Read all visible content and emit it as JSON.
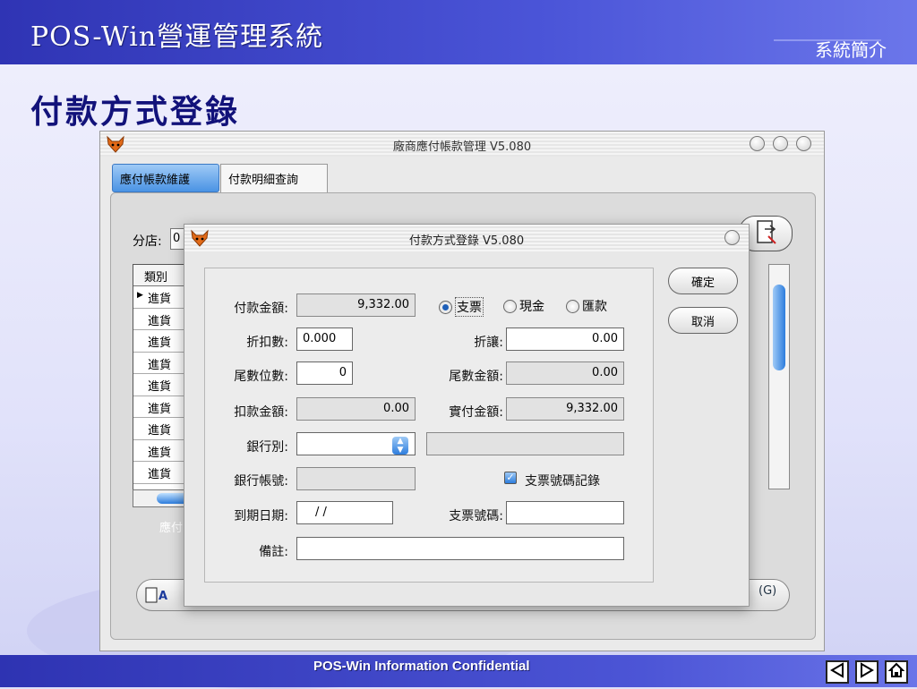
{
  "slide": {
    "system_title": "POS-Win營運管理系統",
    "section": "系統簡介",
    "page_title": "付款方式登錄",
    "footer": "POS-Win Information Confidential",
    "nav": {
      "prev": "◁",
      "next": "▷",
      "home": "⌂"
    }
  },
  "app": {
    "title": "廠商應付帳款管理 V5.080",
    "tabs": [
      {
        "label": "應付帳款維護"
      },
      {
        "label": "付款明細查詢"
      }
    ],
    "branch_label": "分店:",
    "branch_value": "0",
    "grid": {
      "header": "類別",
      "rows": [
        "進貨",
        "進貨",
        "進貨",
        "進貨",
        "進貨",
        "進貨",
        "進貨",
        "進貨",
        "進貨"
      ]
    },
    "faint_label": "應付",
    "g_button": "(G)"
  },
  "dialog": {
    "title": "付款方式登錄 V5.080",
    "confirm": "確定",
    "cancel": "取消",
    "payment_amount_label": "付款金額:",
    "payment_amount": "9,332.00",
    "methods": [
      {
        "label": "支票",
        "selected": true
      },
      {
        "label": "現金",
        "selected": false
      },
      {
        "label": "匯款",
        "selected": false
      }
    ],
    "discount_rate_label": "折扣數:",
    "discount_rate": "0.000",
    "allowance_label": "折讓:",
    "allowance": "0.00",
    "tail_digits_label": "尾數位數:",
    "tail_digits": "0",
    "tail_amount_label": "尾數金額:",
    "tail_amount": "0.00",
    "deduction_label": "扣款金額:",
    "deduction": "0.00",
    "actual_paid_label": "實付金額:",
    "actual_paid": "9,332.00",
    "bank_label": "銀行別:",
    "bank_value": "",
    "bank_account_label": "銀行帳號:",
    "check_record_label": "支票號碼記錄",
    "check_record_checked": true,
    "due_date_label": "到期日期:",
    "due_date": " / /",
    "check_number_label": "支票號碼:",
    "memo_label": "備註:"
  }
}
